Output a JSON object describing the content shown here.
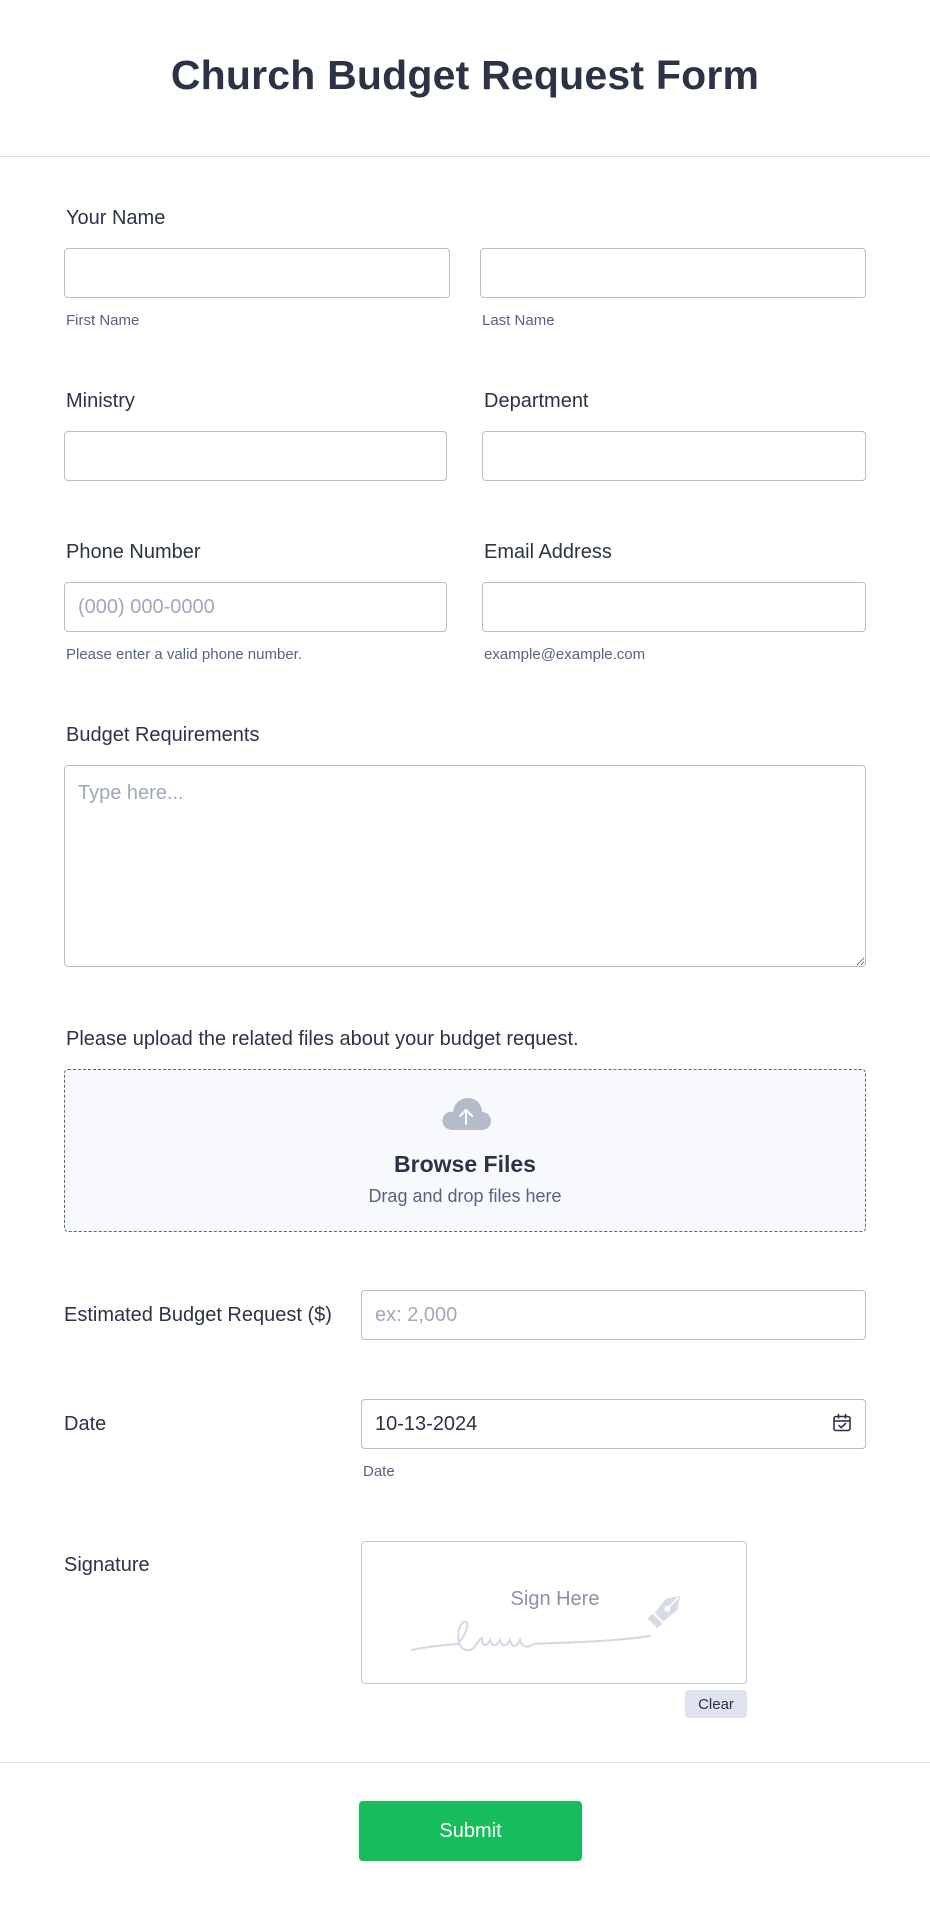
{
  "form": {
    "title": "Church Budget Request Form"
  },
  "name": {
    "label": "Your Name",
    "first_sublabel": "First Name",
    "last_sublabel": "Last Name",
    "first_value": "",
    "last_value": ""
  },
  "ministry": {
    "label": "Ministry",
    "value": ""
  },
  "department": {
    "label": "Department",
    "value": ""
  },
  "phone": {
    "label": "Phone Number",
    "placeholder": "(000) 000-0000",
    "sublabel": "Please enter a valid phone number.",
    "value": ""
  },
  "email": {
    "label": "Email Address",
    "sublabel": "example@example.com",
    "value": ""
  },
  "requirements": {
    "label": "Budget Requirements",
    "placeholder": "Type here..."
  },
  "upload": {
    "label": "Please upload the related files about your budget request.",
    "browse": "Browse Files",
    "drag": "Drag and drop files here",
    "icon": "cloud-upload-icon"
  },
  "estimate": {
    "label": "Estimated Budget Request ($)",
    "placeholder": "ex: 2,000"
  },
  "date": {
    "label": "Date",
    "value": "10-13-2024",
    "sublabel": "Date",
    "icon": "calendar-icon"
  },
  "signature": {
    "label": "Signature",
    "pad_text": "Sign Here",
    "clear_label": "Clear",
    "icon": "pen-icon"
  },
  "footer": {
    "submit_label": "Submit",
    "submit_color": "#18bd5b"
  }
}
